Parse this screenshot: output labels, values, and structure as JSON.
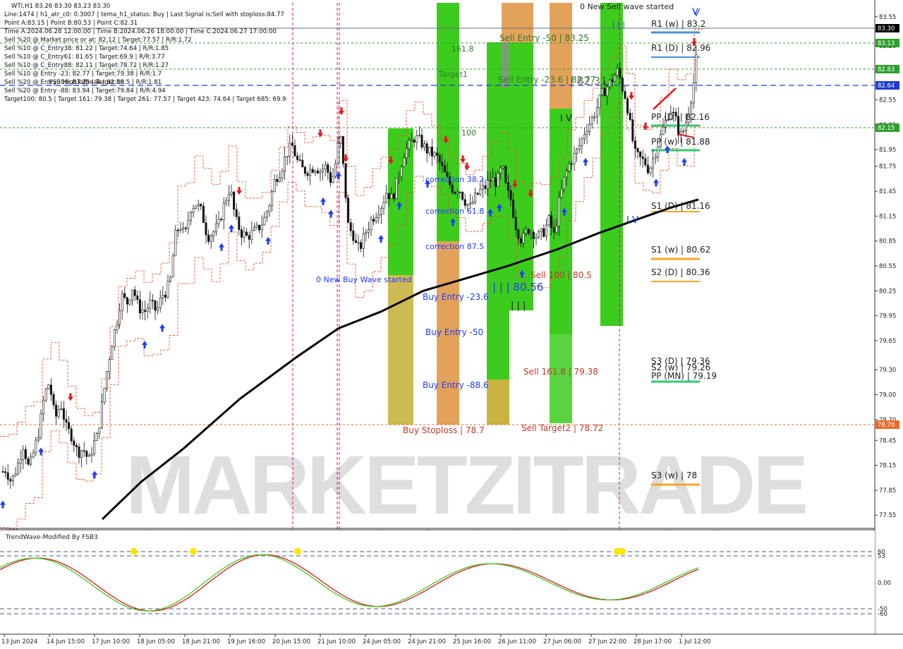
{
  "header": {
    "lines": [
      "WTI,H1  83.26 83.30 83.23 83.30",
      "Line:1474 | h1_atr_c0: 0.3007 | tema_h1_status: Buy | Last Signal is:Sell with stoploss:84.77",
      "Point A:83.15 | Point B:80.53 | Point C:82.31",
      "Time A:2024.06.28 12:00:00 | Time B:2024.06.26 18:00:00 | Time C:2024.06.27 17:00:00",
      "Sell %20 @ Market price or at: 82.12 | Target:77.57 | R/R:1.72",
      "Sell %10 @ C_Entry38: 81.22 | Target:74.64 | R/R:1.85",
      "Sell %10 @ C_Entry61: 81.65 | Target:69.9 | R/R:3.77",
      "Sell %10 @ C_Entry88: 82.11 | Target:78.72 | R/R:1.27",
      "Sell %10 @ Entry -23: 82.77 | Target:79.38 | R/R:1.7",
      "Sell %20 @ Entry -50: 83.25 | Target:80.5 | R/R:1.81",
      "Sell %20 @ Entry -88: 83.94 | Target:79.84 | R/R:4.94",
      "Target100: 80.5 | Target 161: 79.38 | Target 261: 77.57 | Target 423: 74.64 | Target 685: 69.9"
    ],
    "fsb_label": "FSB-HighToBreak | 82.58"
  },
  "watermark": "MARKETZITRADE",
  "price_axis": {
    "ticks": [
      "83.55",
      "83.20",
      "82.90",
      "82.55",
      "82.25",
      "81.95",
      "81.75",
      "81.45",
      "81.15",
      "80.85",
      "80.55",
      "80.25",
      "79.95",
      "79.65",
      "79.30",
      "79.00",
      "78.70",
      "78.45",
      "78.15",
      "77.85",
      "77.55"
    ],
    "badges": [
      {
        "text": "83.30",
        "bg": "#000000",
        "fg": "#ffffff"
      },
      {
        "text": "83.13",
        "bg": "#2e9e2e",
        "fg": "#ffffff"
      },
      {
        "text": "82.83",
        "bg": "#2e9e2e",
        "fg": "#ffffff"
      },
      {
        "text": "82.64",
        "bg": "#1f3bd6",
        "fg": "#ffffff"
      },
      {
        "text": "82.15",
        "bg": "#2e9e2e",
        "fg": "#ffffff"
      },
      {
        "text": "78.70",
        "bg": "#e86b2a",
        "fg": "#ffffff"
      }
    ]
  },
  "time_axis": [
    "13 Jun 2024",
    "14 Jun 15:00",
    "17 Jun 10:00",
    "18 Jun 05:00",
    "18 Jun 21:00",
    "19 Jun 16:00",
    "20 Jun 15:00",
    "21 Jun 10:00",
    "24 Jun 05:00",
    "24 Jun 21:00",
    "25 Jun 16:00",
    "26 Jun 11:00",
    "27 Jun 06:00",
    "27 Jun 22:00",
    "28 Jun 17:00",
    "1 Jul 12:00"
  ],
  "annotations": {
    "new_sell_wave": "0 New Sell wave started",
    "new_buy_wave": "0 New Buy Wave started",
    "sell_entry_50": "Sell Entry -50 | 83.25",
    "sell_entry_23": "Sell Entry -23.6 | 82.77",
    "sell_entry_23_overlay": "| 82.31",
    "fib_161": "161.8",
    "target1": "Target1",
    "fib_100": "100",
    "correction_382": "correction 38.2",
    "correction_618": "correction 61.8",
    "correction_875": "correction 87.5",
    "buy_entry_236": "Buy Entry -23.6",
    "buy_entry_50": "Buy Entry -50",
    "buy_entry_886": "Buy Entry -88.6",
    "buy_stoploss": "Buy Stoploss | 78.7",
    "sell_100": "Sell 100 | 80.5",
    "sell_1618": "Sell 161.8 | 79.38",
    "sell_target2": "Sell Target2 | 78.72",
    "b_level": "| | | 80.56",
    "tick_marks": "| | |",
    "iv_mark": "I V",
    "v_mark": "V",
    "r1_w": "R1 (w) | 83.2",
    "r1_d": "R1 (D) | 82.96",
    "pp_d": "PP (D) | 82.16",
    "pp_w": "PP (w) | 81.88",
    "s1_d": "S1 (D) | 81.16",
    "s1_w": "S1 (w) | 80.62",
    "s2_d": "S2 (D) | 80.36",
    "s3_d": "S3 (D) | 79.36",
    "s2_w": "S2 (w) | 79.26",
    "pp_mn": "PP (MN) | 79.19",
    "s3_w": "S3 (w) | 78"
  },
  "oscillator": {
    "title": "TrendWave-Modified By FSB3",
    "levels": [
      "60",
      "53",
      "0.00",
      "-50",
      "-60"
    ]
  },
  "colors": {
    "up_candle": "#1a7a1a",
    "down_candle": "#1a7a1a",
    "ma_blue": "#1a1a9e",
    "ma_black": "#000000",
    "green_zone": "#3ccc1e",
    "orange_zone": "#e3a25a",
    "olive_zone": "#c9b23f",
    "buy_arrow": "#1e3cff",
    "sell_arrow": "#e8141e",
    "magenta_dash": "#d0158a"
  },
  "chart_data": {
    "type": "candlestick",
    "symbol": "WTI",
    "timeframe": "H1",
    "ohlc_last": {
      "open": 83.26,
      "high": 83.3,
      "low": 83.23,
      "close": 83.3
    },
    "ylim": [
      77.45,
      83.65
    ],
    "close_path": [
      [
        0,
        78.05
      ],
      [
        8,
        78.1
      ],
      [
        16,
        77.95
      ],
      [
        25,
        78.15
      ],
      [
        33,
        78.4
      ],
      [
        41,
        78.1
      ],
      [
        49,
        78.35
      ],
      [
        56,
        78.6
      ],
      [
        63,
        79.0
      ],
      [
        70,
        79.15
      ],
      [
        78,
        78.7
      ],
      [
        86,
        78.9
      ],
      [
        94,
        78.6
      ],
      [
        102,
        78.5
      ],
      [
        110,
        78.3
      ],
      [
        118,
        78.35
      ],
      [
        126,
        78.2
      ],
      [
        132,
        78.4
      ],
      [
        138,
        78.5
      ],
      [
        145,
        78.9
      ],
      [
        150,
        79.2
      ],
      [
        158,
        79.6
      ],
      [
        166,
        79.9
      ],
      [
        172,
        80.2
      ],
      [
        180,
        80.1
      ],
      [
        188,
        80.3
      ],
      [
        196,
        80.05
      ],
      [
        205,
        80.0
      ],
      [
        213,
        80.1
      ],
      [
        222,
        80.0
      ],
      [
        230,
        80.2
      ],
      [
        236,
        80.25
      ],
      [
        242,
        80.4
      ],
      [
        248,
        80.9
      ],
      [
        255,
        81.05
      ],
      [
        262,
        80.9
      ],
      [
        270,
        81.25
      ],
      [
        278,
        81.3
      ],
      [
        286,
        81.2
      ],
      [
        294,
        80.9
      ],
      [
        302,
        80.95
      ],
      [
        310,
        81.05
      ],
      [
        318,
        81.3
      ],
      [
        326,
        81.5
      ],
      [
        334,
        81.1
      ],
      [
        342,
        80.95
      ],
      [
        350,
        80.9
      ],
      [
        358,
        80.95
      ],
      [
        366,
        81.0
      ],
      [
        374,
        81.1
      ],
      [
        382,
        81.3
      ],
      [
        390,
        81.6
      ],
      [
        398,
        81.7
      ],
      [
        406,
        81.9
      ],
      [
        414,
        82.0
      ],
      [
        422,
        81.8
      ],
      [
        430,
        81.7
      ],
      [
        438,
        81.7
      ],
      [
        446,
        81.75
      ],
      [
        454,
        81.7
      ],
      [
        462,
        81.75
      ],
      [
        470,
        81.55
      ],
      [
        476,
        81.8
      ],
      [
        482,
        82.15
      ],
      [
        488,
        81.6
      ],
      [
        494,
        81.0
      ],
      [
        500,
        80.95
      ],
      [
        506,
        80.75
      ],
      [
        512,
        80.8
      ],
      [
        518,
        80.95
      ],
      [
        526,
        81.1
      ],
      [
        534,
        81.2
      ],
      [
        542,
        81.3
      ],
      [
        548,
        81.45
      ],
      [
        556,
        81.35
      ],
      [
        564,
        81.6
      ],
      [
        572,
        81.9
      ],
      [
        580,
        82.0
      ],
      [
        588,
        82.1
      ],
      [
        596,
        82.05
      ],
      [
        604,
        81.95
      ],
      [
        612,
        81.9
      ],
      [
        620,
        81.85
      ],
      [
        628,
        81.7
      ],
      [
        636,
        81.55
      ],
      [
        644,
        81.45
      ],
      [
        650,
        81.5
      ],
      [
        658,
        81.35
      ],
      [
        666,
        81.25
      ],
      [
        672,
        81.35
      ],
      [
        680,
        81.45
      ],
      [
        688,
        81.5
      ],
      [
        696,
        81.6
      ],
      [
        704,
        81.55
      ],
      [
        712,
        81.75
      ],
      [
        718,
        81.45
      ],
      [
        724,
        81.35
      ],
      [
        732,
        81.0
      ],
      [
        740,
        80.85
      ],
      [
        748,
        81.0
      ],
      [
        756,
        80.95
      ],
      [
        762,
        80.9
      ],
      [
        770,
        80.95
      ],
      [
        778,
        81.1
      ],
      [
        786,
        80.9
      ],
      [
        792,
        81.3
      ],
      [
        800,
        81.6
      ],
      [
        808,
        81.8
      ],
      [
        816,
        81.9
      ],
      [
        824,
        82.05
      ],
      [
        830,
        82.2
      ],
      [
        838,
        82.3
      ],
      [
        846,
        82.45
      ],
      [
        852,
        82.6
      ],
      [
        860,
        82.7
      ],
      [
        868,
        82.8
      ],
      [
        876,
        82.9
      ],
      [
        882,
        82.7
      ],
      [
        888,
        82.55
      ],
      [
        894,
        82.2
      ],
      [
        900,
        81.9
      ],
      [
        906,
        81.85
      ],
      [
        914,
        81.8
      ],
      [
        920,
        81.7
      ],
      [
        928,
        81.9
      ],
      [
        936,
        82.1
      ],
      [
        944,
        82.3
      ],
      [
        950,
        82.45
      ],
      [
        958,
        82.3
      ],
      [
        964,
        82.1
      ],
      [
        970,
        82.2
      ],
      [
        978,
        82.5
      ],
      [
        984,
        82.8
      ],
      [
        990,
        83.3
      ]
    ]
  }
}
